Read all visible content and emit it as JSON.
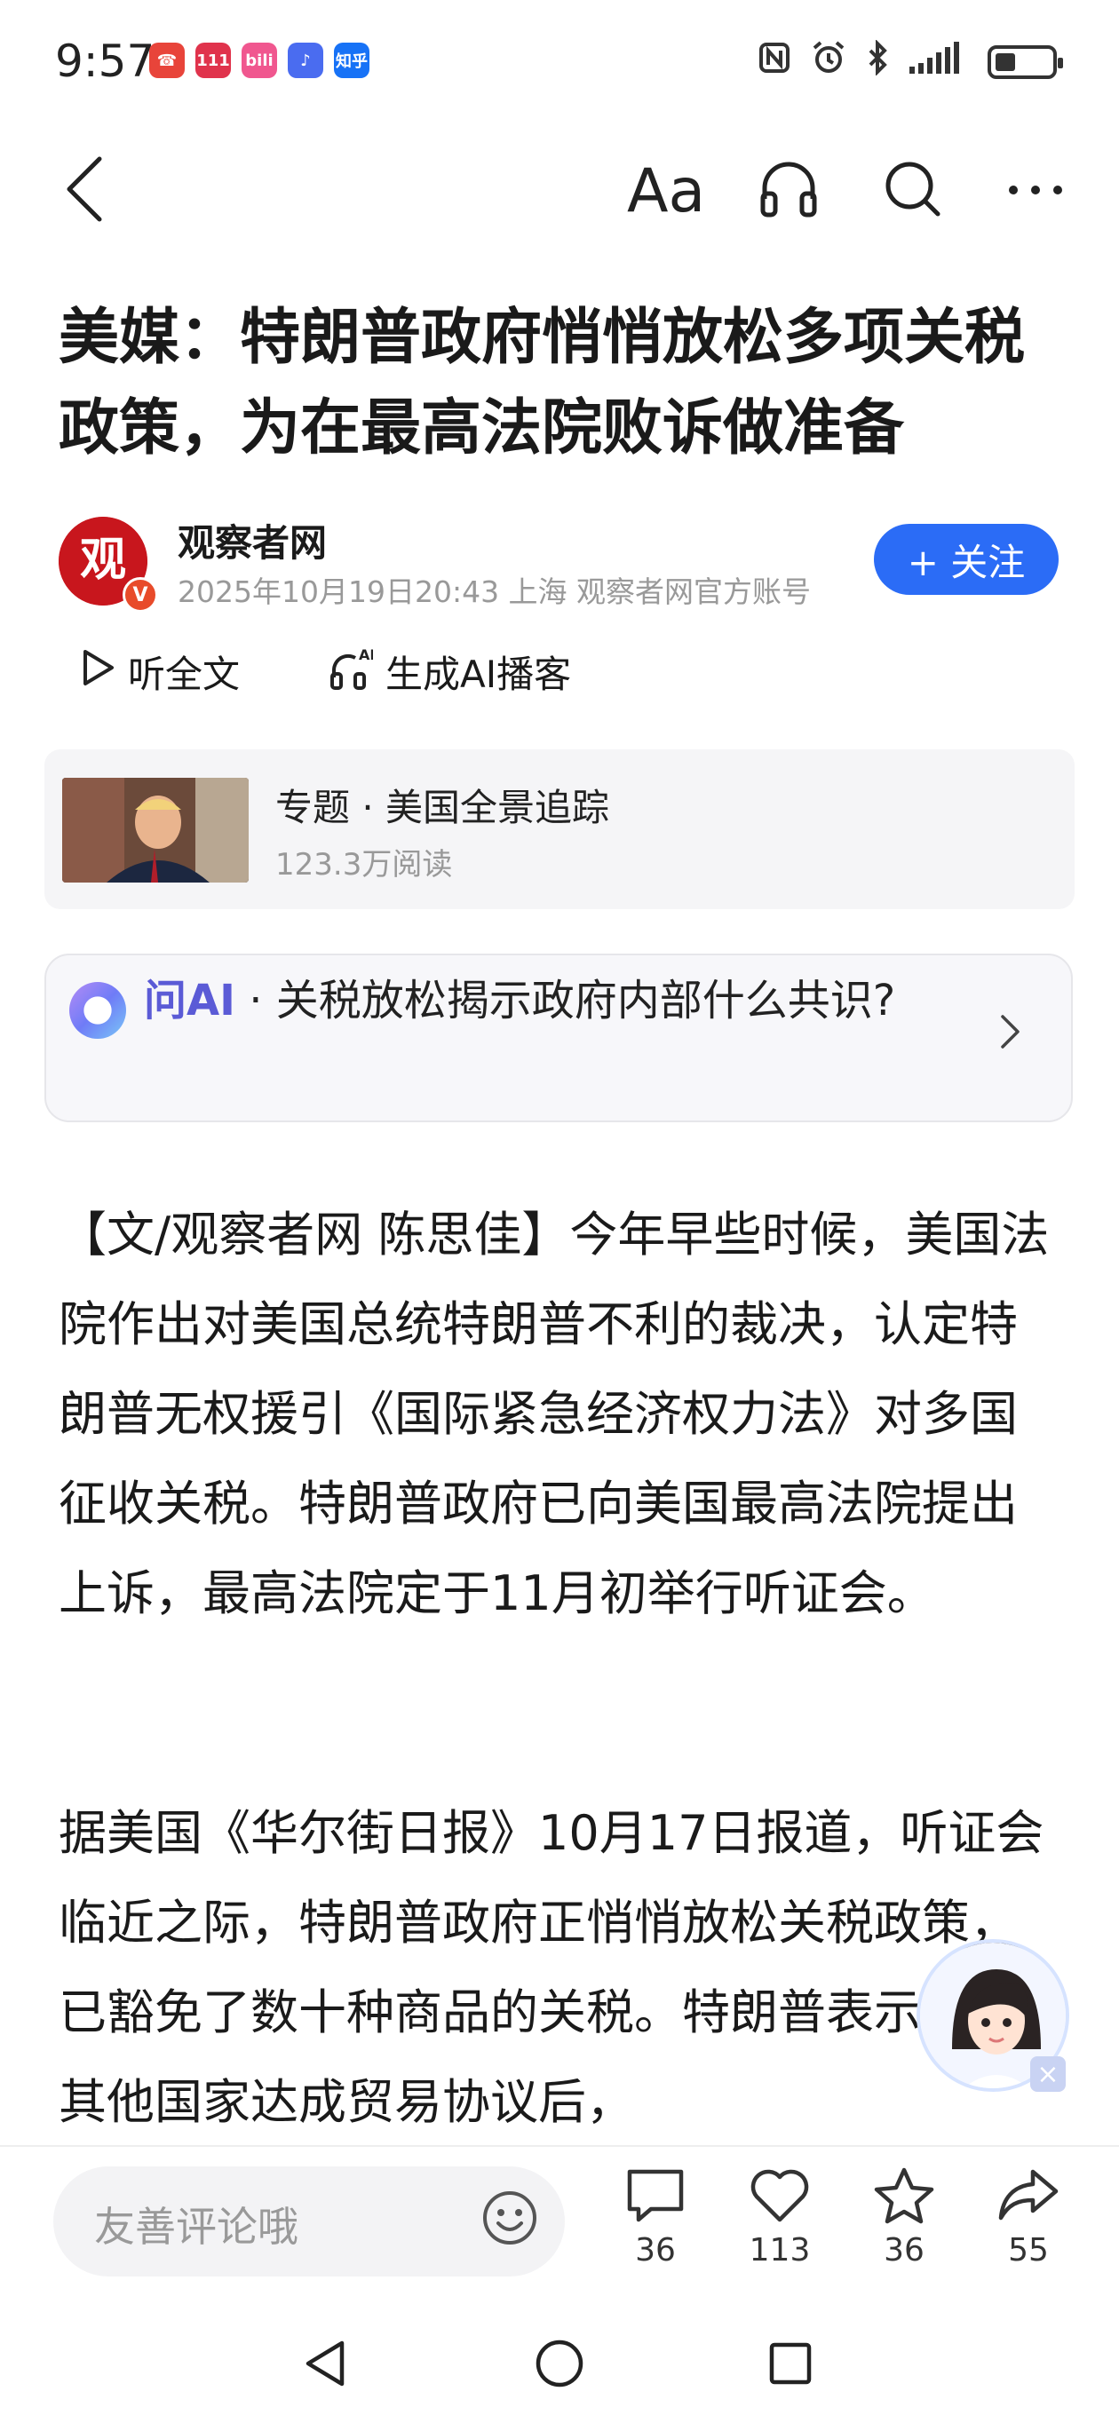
{
  "status_bar": {
    "time": "9:57",
    "app_icons": [
      {
        "name": "missed-call-icon",
        "glyph": "☎",
        "color": "#e8443a"
      },
      {
        "name": "game-app-icon",
        "glyph": "111",
        "color": "#e0334c"
      },
      {
        "name": "bilibili-icon",
        "glyph": "bili",
        "color": "#f0578f"
      },
      {
        "name": "music-app-icon",
        "glyph": "♪",
        "color": "#4a6cf0"
      },
      {
        "name": "zhihu-icon",
        "glyph": "知乎",
        "color": "#1772f6"
      }
    ]
  },
  "toolbar": {
    "back_icon": "chevron-left-icon",
    "font_size_label": "Aa",
    "listen_icon": "headphones-icon",
    "search_icon": "search-icon",
    "more_icon": "more-icon"
  },
  "article": {
    "title": "美媒：特朗普政府悄悄放松多项关税政策，为在最高法院败诉做准备",
    "author": "观察者网",
    "avatar_text": "观",
    "meta": "2025年10月19日20:43 上海 观察者网官方账号",
    "follow_label": "+ 关注",
    "listen_label": "听全文",
    "podcast_label": "生成AI播客",
    "paragraphs": [
      "【文/观察者网 陈思佳】今年早些时候，美国法院作出对美国总统特朗普不利的裁决，认定特朗普无权援引《国际紧急经济权力法》对多国征收关税。特朗普政府已向美国最高法院提出上诉，最高法院定于11月初举行听证会。",
      "据美国《华尔街日报》10月17日报道，听证会临近之际，特朗普政府正悄悄放松关税政策，已豁免了数十种商品的关税。特朗普表示，与其他国家达成贸易协议后，"
    ]
  },
  "topic": {
    "title": "专题 · 美国全景追踪",
    "reads": "123.3万阅读"
  },
  "ask_ai": {
    "label": "问AI",
    "question": " · 关税放松揭示政府内部什么共识?"
  },
  "bottom": {
    "comment_placeholder": "友善评论哦",
    "comments": "36",
    "likes": "113",
    "favorites": "36",
    "shares": "55"
  },
  "colors": {
    "accent": "#2b6cf6",
    "brand_red": "#c8161d",
    "ai_purple": "#5b5bd6"
  }
}
